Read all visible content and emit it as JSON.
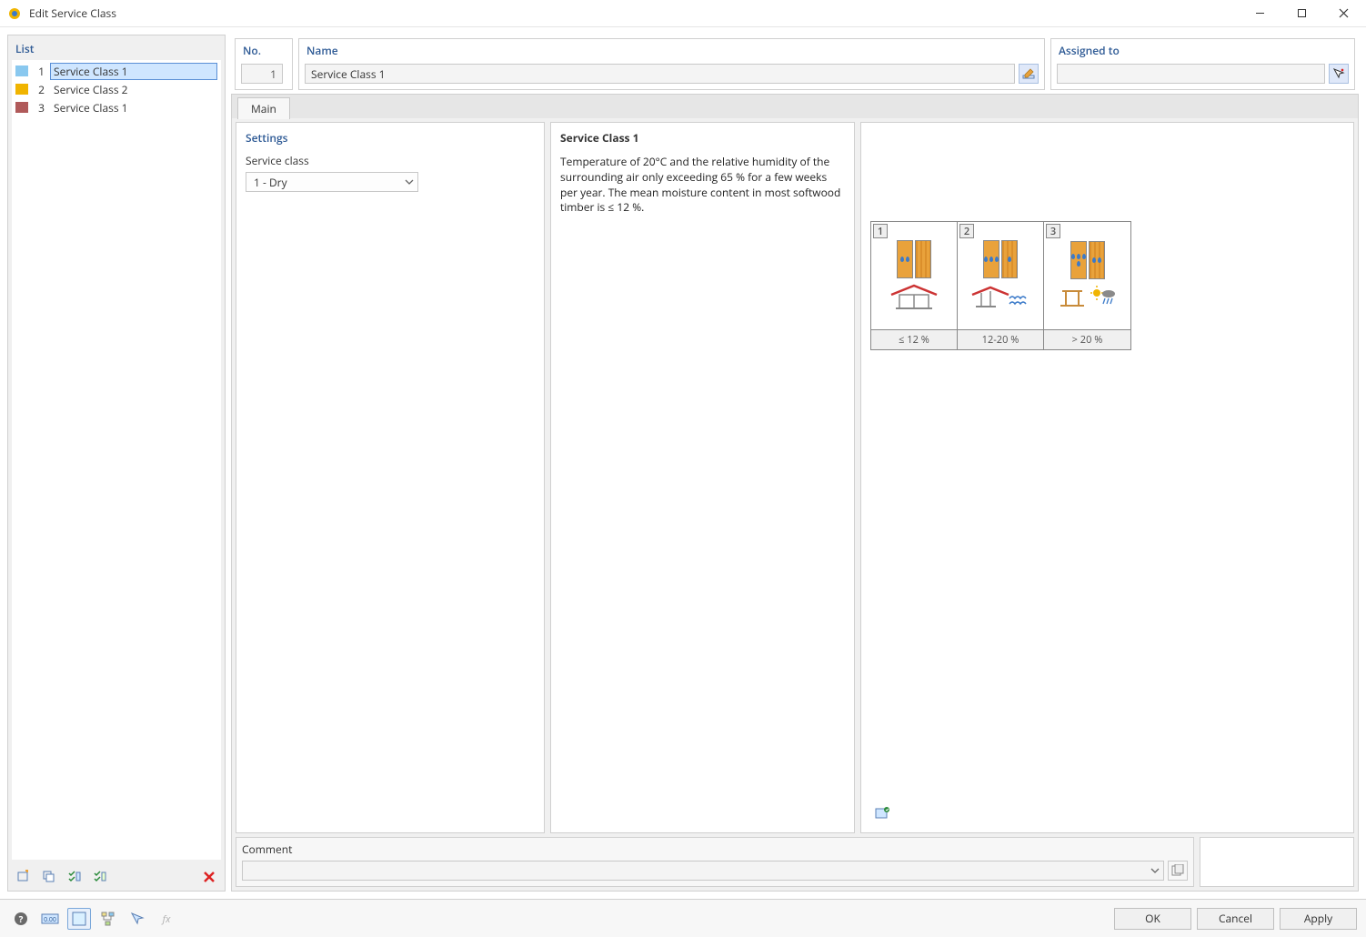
{
  "window_title": "Edit Service Class",
  "left": {
    "header": "List",
    "items": [
      {
        "no": "1",
        "name": "Service Class 1",
        "color": "c1",
        "selected": true
      },
      {
        "no": "2",
        "name": "Service Class 2",
        "color": "c2",
        "selected": false
      },
      {
        "no": "3",
        "name": "Service Class 1",
        "color": "c3",
        "selected": false
      }
    ]
  },
  "header": {
    "no_label": "No.",
    "no_value": "1",
    "name_label": "Name",
    "name_value": "Service Class 1",
    "assigned_label": "Assigned to",
    "assigned_value": ""
  },
  "tab_main": "Main",
  "settings": {
    "title": "Settings",
    "field_label": "Service class",
    "field_value": "1 - Dry"
  },
  "description": {
    "title": "Service Class 1",
    "text": "Temperature of 20°C and the relative humidity of the surrounding air only exceeding 65 % for a few weeks per year. The mean moisture content in most softwood timber is ≤ 12 %."
  },
  "illustration": {
    "cards": [
      {
        "num": "1",
        "caption": "≤ 12 %"
      },
      {
        "num": "2",
        "caption": "12-20 %"
      },
      {
        "num": "3",
        "caption": "> 20 %"
      }
    ]
  },
  "comment": {
    "title": "Comment",
    "value": ""
  },
  "footer": {
    "ok": "OK",
    "cancel": "Cancel",
    "apply": "Apply"
  }
}
